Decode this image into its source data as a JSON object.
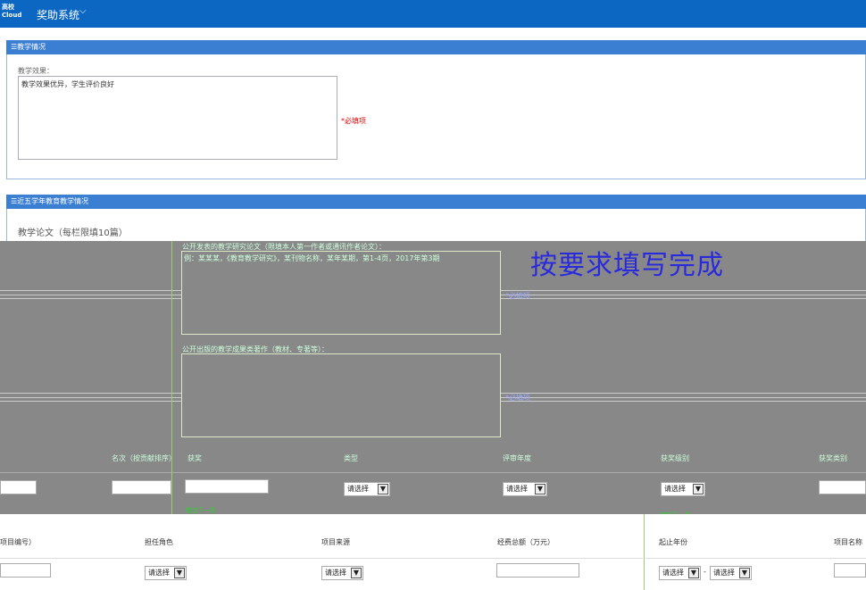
{
  "topbar": {
    "logo_text": "高校 Cloud",
    "app_name": "奖助系统",
    "dropdown_icon": "chevron-down"
  },
  "teaching": {
    "section_title": "☰教学情况",
    "effect_label": "教学效果：",
    "effect_value": "教学效果优异，学生评价良好",
    "required_mark": "*必填项"
  },
  "five_year": {
    "section_title": "☰近五学年教育教学情况",
    "papers_title": "教学论文（每栏限填10篇）",
    "overlay_q1_label": "公开发表的教学研究论文（限填本人第一作者或通讯作者论文）：",
    "overlay_q1_value": "例：某某某，《教育教学研究》，某刊物名称，某年某期，第1-4页，2017年第3期",
    "overlay_q2_label": "公开出版的教学成果类著作（教材、专著等）：",
    "required_mark": "*必填项",
    "banner": "按要求填写完成",
    "gray_headers": [
      "名次（按贡献排序）",
      "获奖",
      "类型",
      "评审年度",
      "获奖级别",
      "获奖类别"
    ],
    "select_placeholder": "请选择",
    "add_row_link": "增加下一条"
  },
  "projects": {
    "headers": [
      "项目编号）",
      "担任角色",
      "项目来源",
      "经费总额（万元）",
      "起止年份",
      "项目名称（"
    ],
    "select_placeholder": "请选择",
    "year_separator": "-"
  }
}
